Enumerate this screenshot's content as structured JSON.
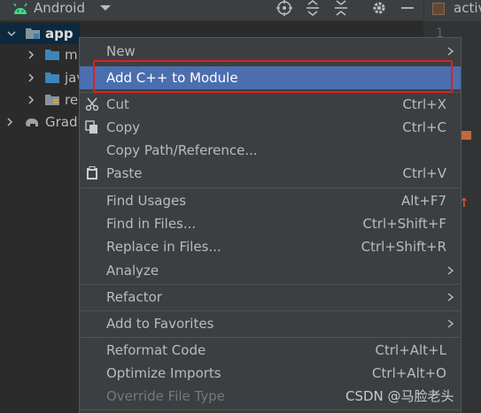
{
  "toolbar": {
    "title": "Android",
    "icons": [
      "android-icon",
      "dropdown-arrow-icon",
      "locate-target-icon",
      "expand-all-icon",
      "collapse-all-icon",
      "gear-icon",
      "hide-minus-icon"
    ]
  },
  "editor_tab": {
    "label": "activ",
    "line_number": "1"
  },
  "tree": {
    "app": "app",
    "manifests": "m",
    "java": "jav",
    "res": "re",
    "gradle": "Gradl"
  },
  "menu": {
    "new": "New",
    "add_cpp": "Add C++ to Module",
    "cut": "Cut",
    "cut_shortcut": "Ctrl+X",
    "copy": "Copy",
    "copy_shortcut": "Ctrl+C",
    "copy_path": "Copy Path/Reference...",
    "paste": "Paste",
    "paste_shortcut": "Ctrl+V",
    "find_usages": "Find Usages",
    "find_usages_shortcut": "Alt+F7",
    "find_in_files": "Find in Files...",
    "find_in_files_shortcut": "Ctrl+Shift+F",
    "replace_in_files": "Replace in Files...",
    "replace_in_files_shortcut": "Ctrl+Shift+R",
    "analyze": "Analyze",
    "refactor": "Refactor",
    "add_to_favorites": "Add to Favorites",
    "reformat_code": "Reformat Code",
    "reformat_code_shortcut": "Ctrl+Alt+L",
    "optimize_imports": "Optimize Imports",
    "optimize_imports_shortcut": "Ctrl+Alt+O",
    "override_file_type": "Override File Type"
  },
  "watermark": "CSDN @马脸老头",
  "colors": {
    "menu_bg": "#3c3f41",
    "highlight": "#4b6eaf",
    "annotation_red": "#e02020",
    "android_green": "#3ddc84"
  }
}
